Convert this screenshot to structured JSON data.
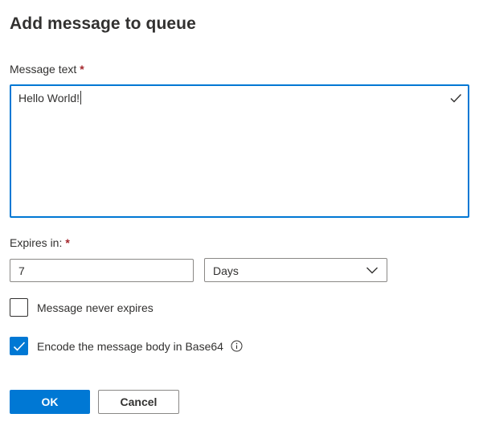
{
  "dialog": {
    "title": "Add message to queue"
  },
  "message_text": {
    "label": "Message text",
    "required_marker": "*",
    "value": "Hello World!"
  },
  "expires": {
    "label": "Expires in:",
    "required_marker": "*",
    "value": "7",
    "unit_selected": "Days"
  },
  "options": {
    "never_expires": {
      "label": "Message never expires",
      "checked": false
    },
    "encode_base64": {
      "label": "Encode the message body in Base64",
      "checked": true
    }
  },
  "buttons": {
    "ok": "OK",
    "cancel": "Cancel"
  },
  "colors": {
    "accent": "#0078d4",
    "required": "#a4262c",
    "text": "#323130",
    "border": "#8a8886"
  },
  "icons": {
    "valid": "checkmark-icon",
    "dropdown": "chevron-down-icon",
    "info": "info-icon"
  }
}
